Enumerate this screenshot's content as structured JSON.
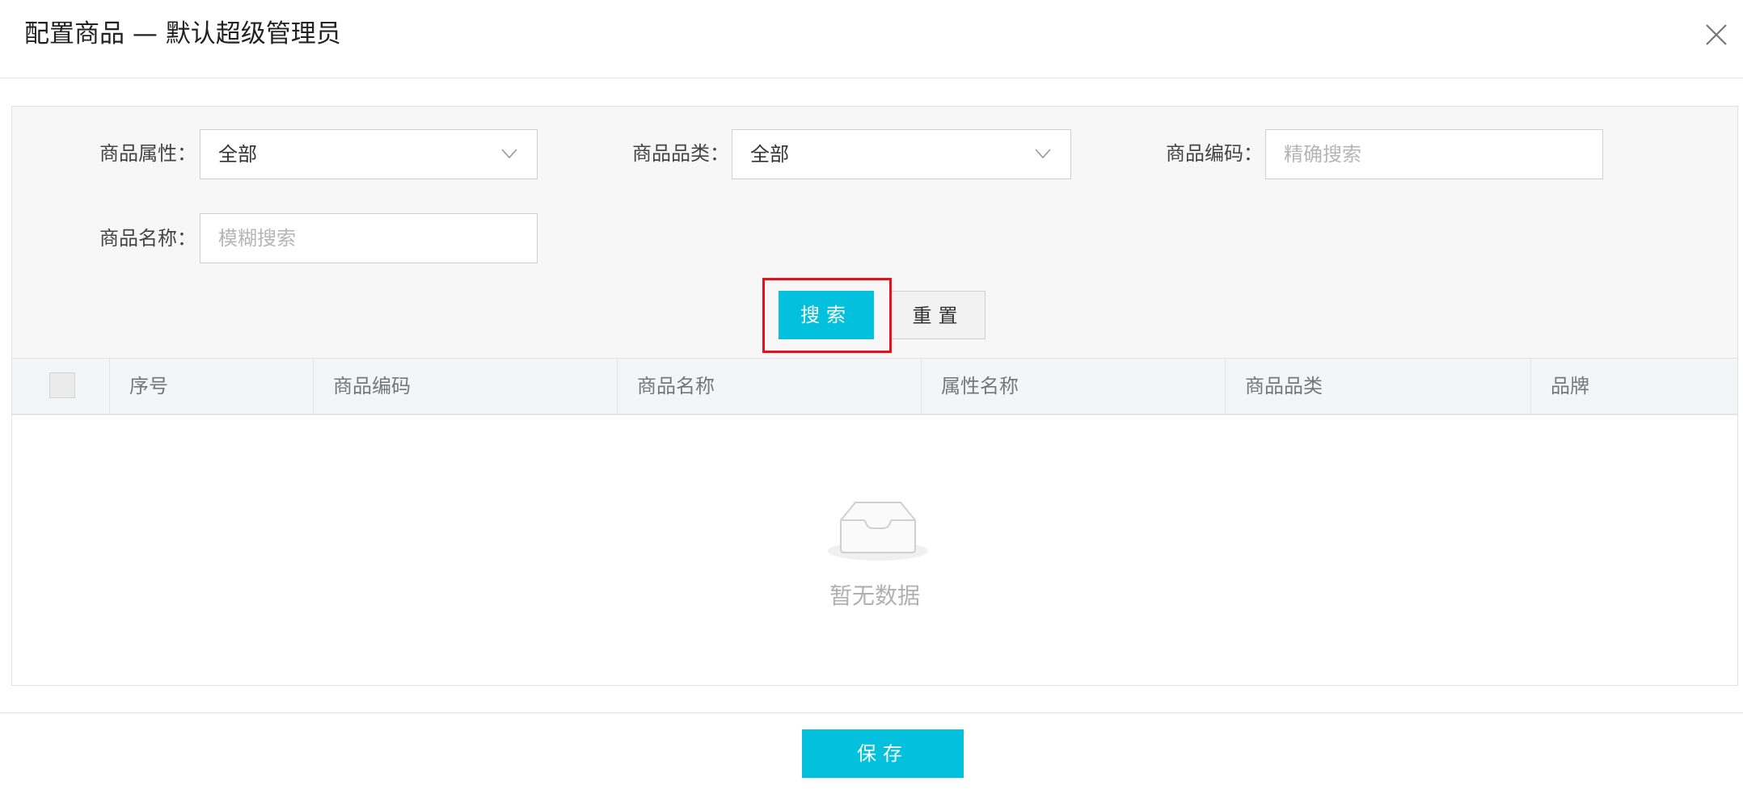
{
  "modal": {
    "title": "配置商品 — 默认超级管理员"
  },
  "filters": {
    "attribute": {
      "label": "商品属性：",
      "value": "全部"
    },
    "category": {
      "label": "商品品类：",
      "value": "全部"
    },
    "code": {
      "label": "商品编码：",
      "placeholder": "精确搜索"
    },
    "name": {
      "label": "商品名称：",
      "placeholder": "模糊搜索"
    },
    "search_label": "搜索",
    "reset_label": "重置"
  },
  "table": {
    "columns": [
      "序号",
      "商品编码",
      "商品名称",
      "属性名称",
      "商品品类",
      "品牌"
    ],
    "rows": [],
    "empty_text": "暂无数据"
  },
  "footer": {
    "save_label": "保存"
  },
  "colors": {
    "primary": "#03c0dc",
    "highlight": "#e8101c"
  }
}
